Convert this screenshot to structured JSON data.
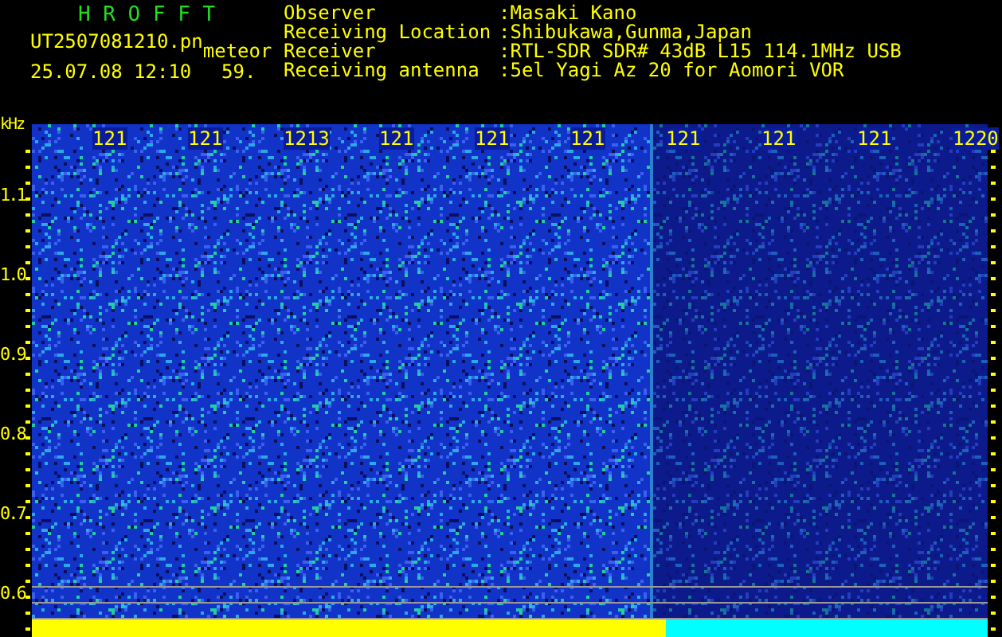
{
  "header": {
    "title": "H R O F F T",
    "file": "UT2507081210.pn",
    "tag": "meteor",
    "datetime": "25.07.08 12:10",
    "count": "59."
  },
  "info": [
    {
      "label": "Observer",
      "value": ":Masaki Kano"
    },
    {
      "label": "Receiving Location",
      "value": ":Shibukawa,Gunma,Japan"
    },
    {
      "label": "Receiver",
      "value": ":RTL-SDR SDR# 43dB L15 114.1MHz USB"
    },
    {
      "label": "Receiving antenna",
      "value": ":5el Yagi Az 20 for Aomori VOR"
    }
  ],
  "axis": {
    "unit": "kHz",
    "y_labels": [
      "1.1",
      "1.0",
      "0.9",
      "0.8",
      "0.7",
      "0.6"
    ],
    "time_labels": [
      "121",
      "121",
      "1213",
      "121",
      "121",
      "121",
      "121",
      "121",
      "121",
      "1220"
    ]
  }
}
